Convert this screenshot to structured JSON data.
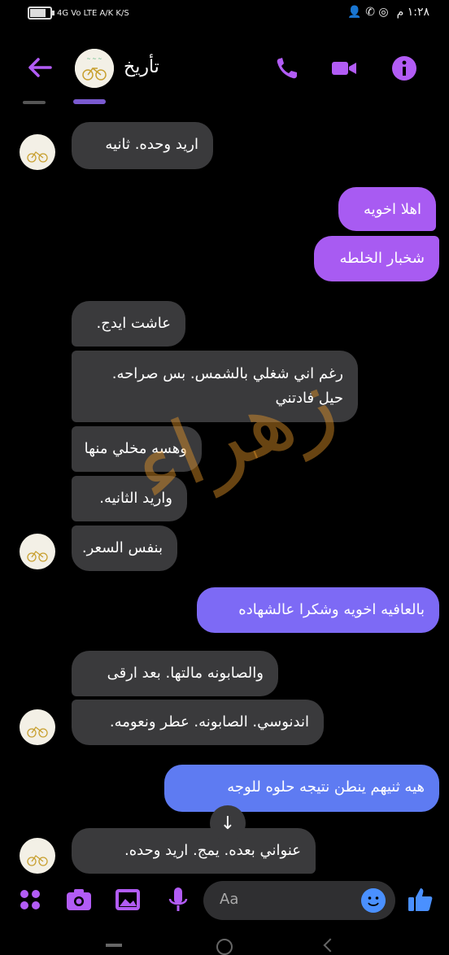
{
  "status_bar": {
    "left_indicators": "4G  Vo LTE  A/K K/S",
    "time": "١:٢٨ م",
    "battery_level": 0.85
  },
  "header": {
    "title": "تأريخ"
  },
  "watermark": "زهراء",
  "messages": [
    {
      "text": "اريد وحده. ثانيه"
    },
    {
      "text": "اهلا اخويه"
    },
    {
      "text": "شخبار الخلطه"
    },
    {
      "text": "عاشت ايدج."
    },
    {
      "text": "رغم اني شغلي بالشمس.  بس صراحه.",
      "text2": "حيل فادتني"
    },
    {
      "text": "وهسه مخلي منها"
    },
    {
      "text": "واريد الثانيه."
    },
    {
      "text": "بنفس السعر."
    },
    {
      "text": "بالعافيه اخويه وشكرا عالشهاده"
    },
    {
      "text": "والصابونه مالتها. بعد ارقى"
    },
    {
      "text": "اندنوسي. الصابونه. عطر ونعومه."
    },
    {
      "text": "هيه ثنيهم ينطن نتيجه حلوه للوجه"
    },
    {
      "text": "عنواني بعده. يمج.   اريد وحده."
    }
  ],
  "composer": {
    "placeholder": "Aa"
  },
  "colors": {
    "accent": "#b25cf5",
    "incoming_bubble": "#3a3a3c",
    "outgoing_bubble_top": "#a85bf2",
    "outgoing_bubble_bottom": "#5e7bf2"
  }
}
